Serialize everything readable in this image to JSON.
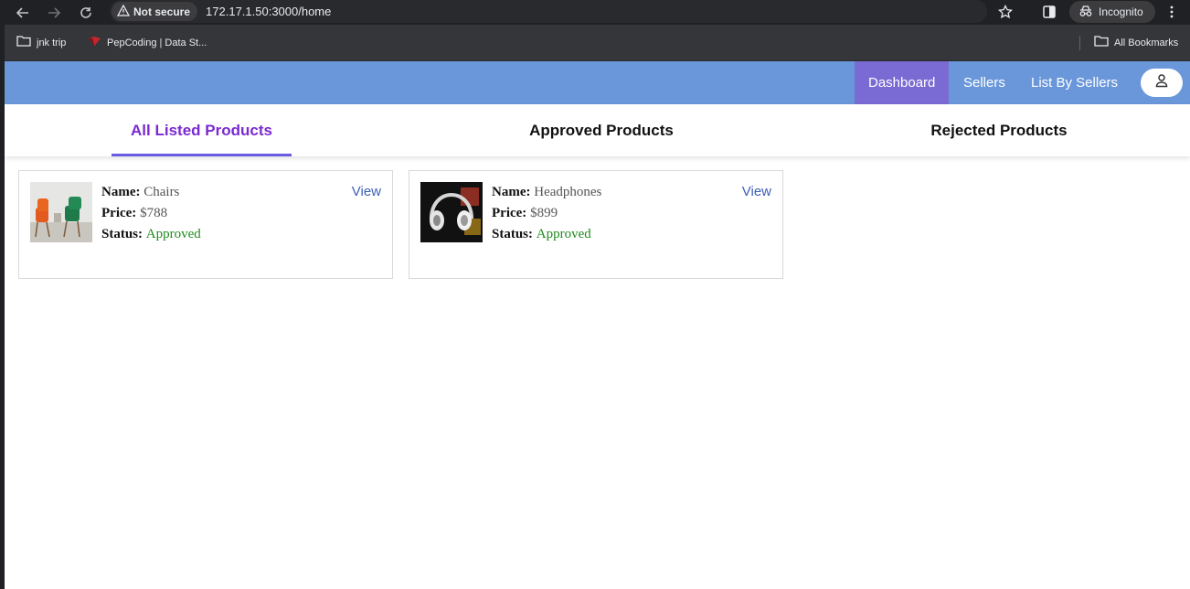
{
  "browser": {
    "security_label": "Not secure",
    "url": "172.17.1.50:3000/home",
    "incognito_label": "Incognito",
    "bookmarks": [
      {
        "label": "jnk trip"
      },
      {
        "label": "PepCoding | Data St..."
      }
    ],
    "all_bookmarks_label": "All Bookmarks"
  },
  "app": {
    "nav": [
      {
        "label": "Dashboard",
        "active": true
      },
      {
        "label": "Sellers",
        "active": false
      },
      {
        "label": "List By Sellers",
        "active": false
      }
    ],
    "tabs": [
      {
        "label": "All Listed Products",
        "active": true
      },
      {
        "label": "Approved Products",
        "active": false
      },
      {
        "label": "Rejected Products",
        "active": false
      }
    ],
    "products": [
      {
        "name_label": "Name:",
        "name": "Chairs",
        "price_label": "Price:",
        "price": "$788",
        "status_label": "Status:",
        "status": "Approved",
        "view_label": "View",
        "image_icon": "chairs-image"
      },
      {
        "name_label": "Name:",
        "name": "Headphones",
        "price_label": "Price:",
        "price": "$899",
        "status_label": "Status:",
        "status": "Approved",
        "view_label": "View",
        "image_icon": "headphones-image"
      }
    ]
  },
  "colors": {
    "header_bg": "#6a97da",
    "active_nav_bg": "#7a6ad3",
    "active_tab_text": "#7a2ad0",
    "status_approved": "#1e8a1e",
    "view_link": "#3c5fb5"
  }
}
